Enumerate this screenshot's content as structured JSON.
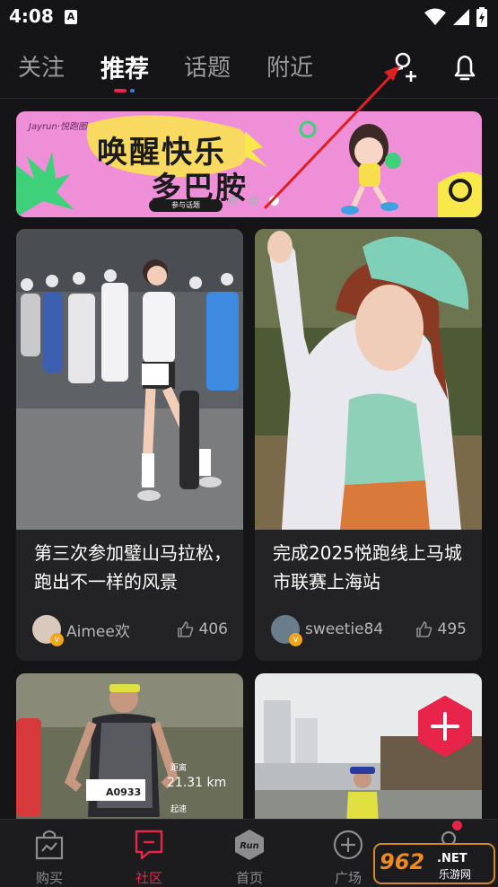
{
  "status_bar": {
    "time": "4:08",
    "notification_glyph": "A"
  },
  "top_tabs": [
    {
      "label": "关注"
    },
    {
      "label": "推荐",
      "active": true
    },
    {
      "label": "话题"
    },
    {
      "label": "附近"
    }
  ],
  "top_icons": [
    "add-friend-icon",
    "bell-icon"
  ],
  "banner": {
    "brand": "Jayrun·悦跑圈",
    "title_line1": "唤醒快乐",
    "title_line2": "多巴胺",
    "cta": "参与话题",
    "dots_count": 3,
    "active_dot": 3
  },
  "feed": [
    {
      "title": "第三次参加璧山马拉松，跑出不一样的风景",
      "author": "Aimee欢",
      "likes": "406",
      "vip": "V"
    },
    {
      "title": "完成2025悦跑线上马城市联赛上海站",
      "author": "sweetie84",
      "likes": "495",
      "vip": "V"
    },
    {
      "photo_text_distance_label": "距离",
      "photo_text_distance": "21.31 km",
      "photo_text_time_label": "起速",
      "photo_text_bib": "A0933"
    },
    {}
  ],
  "fab": {
    "icon": "plus-icon",
    "color": "#e8244a"
  },
  "bottom_nav": [
    {
      "label": "购买",
      "icon": "bag-icon"
    },
    {
      "label": "社区",
      "icon": "chat-icon",
      "active": true
    },
    {
      "label": "首页",
      "icon": "run-logo-icon",
      "logo_text": "Run"
    },
    {
      "label": "广场",
      "icon": "plus-circle-icon"
    },
    {
      "label": "",
      "icon": "profile-icon"
    }
  ],
  "watermark": {
    "main": "962",
    "sub": ".NET",
    "tagline": "乐游网"
  },
  "colors": {
    "accent": "#e8244a",
    "background": "#151517",
    "card": "#232325"
  }
}
